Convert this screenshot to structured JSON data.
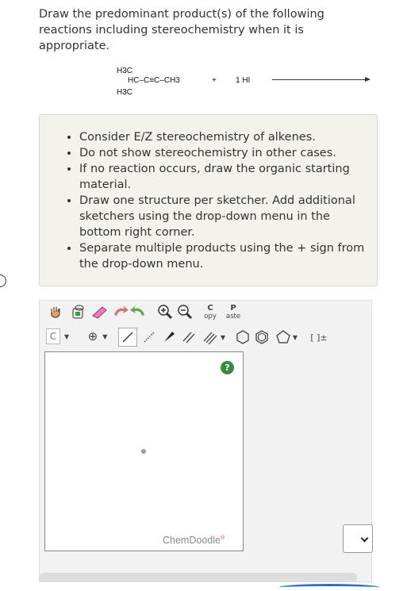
{
  "question": "Draw the predominant product(s) of the following reactions including stereochemistry when it is appropriate.",
  "reaction": {
    "h3c_top": "H3C",
    "chain": "HC–C≡C–CH3",
    "h3c_bottom": "H3C",
    "plus": "+",
    "reagent": "1 HI"
  },
  "instructions": [
    "Consider E/Z stereochemistry of alkenes.",
    "Do not show stereochemistry in other cases.",
    "If no reaction occurs, draw the organic starting material.",
    "Draw one structure per sketcher. Add additional sketchers using the drop-down menu in the bottom right corner.",
    "Separate multiple products using the + sign from the drop-down menu."
  ],
  "toolbar": {
    "copy_top": "C",
    "copy_bottom": "opy",
    "paste_top": "P",
    "paste_bottom": "aste",
    "atom_label": "C",
    "charge_label": "⊕",
    "bracket_label": "[ ]±"
  },
  "editor": {
    "help": "?",
    "brand": "ChemDoodle",
    "brand_mark": "®"
  }
}
